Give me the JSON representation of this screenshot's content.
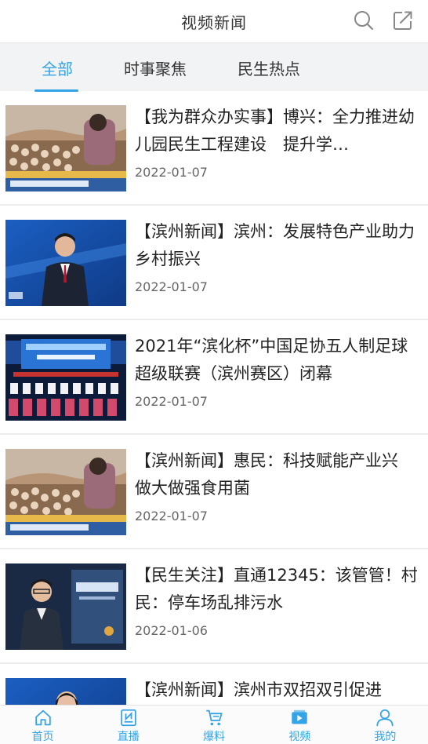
{
  "header": {
    "title": "视频新闻",
    "icons": [
      "search-icon",
      "share-icon"
    ]
  },
  "tabs": [
    {
      "label": "全部",
      "active": true
    },
    {
      "label": "时事聚焦",
      "active": false
    },
    {
      "label": "民生热点",
      "active": false
    }
  ],
  "news": [
    {
      "title": "【我为群众办实事】博兴：全力推进幼儿园民生工程建设　提升学…",
      "date": "2022-01-07",
      "thumb": "mushroom-greenhouse"
    },
    {
      "title": "【滨州新闻】滨州：发展特色产业助力乡村振兴",
      "date": "2022-01-07",
      "thumb": "news-anchor"
    },
    {
      "title": "2021年“滨化杯”中国足协五人制足球超级联赛（滨州赛区）闭幕",
      "date": "2022-01-07",
      "thumb": "ceremony-stage"
    },
    {
      "title": "【滨州新闻】惠民：科技赋能产业兴　做大做强食用菌",
      "date": "2022-01-07",
      "thumb": "mushroom-greenhouse"
    },
    {
      "title": "【民生关注】直通12345：该管管！村民：停车场乱排污水",
      "date": "2022-01-06",
      "thumb": "studio-host"
    },
    {
      "title": "【滨州新闻】滨州市双招双引促进",
      "date": "",
      "thumb": "news-anchor-female"
    }
  ],
  "bottom_nav": [
    {
      "label": "首页",
      "icon": "home-icon"
    },
    {
      "label": "直播",
      "icon": "live-icon"
    },
    {
      "label": "爆料",
      "icon": "cart-icon"
    },
    {
      "label": "视频",
      "icon": "video-icon"
    },
    {
      "label": "我的",
      "icon": "user-icon"
    }
  ],
  "colors": {
    "accent": "#35a4e6",
    "tabbar_bg": "#f2f3f5"
  }
}
